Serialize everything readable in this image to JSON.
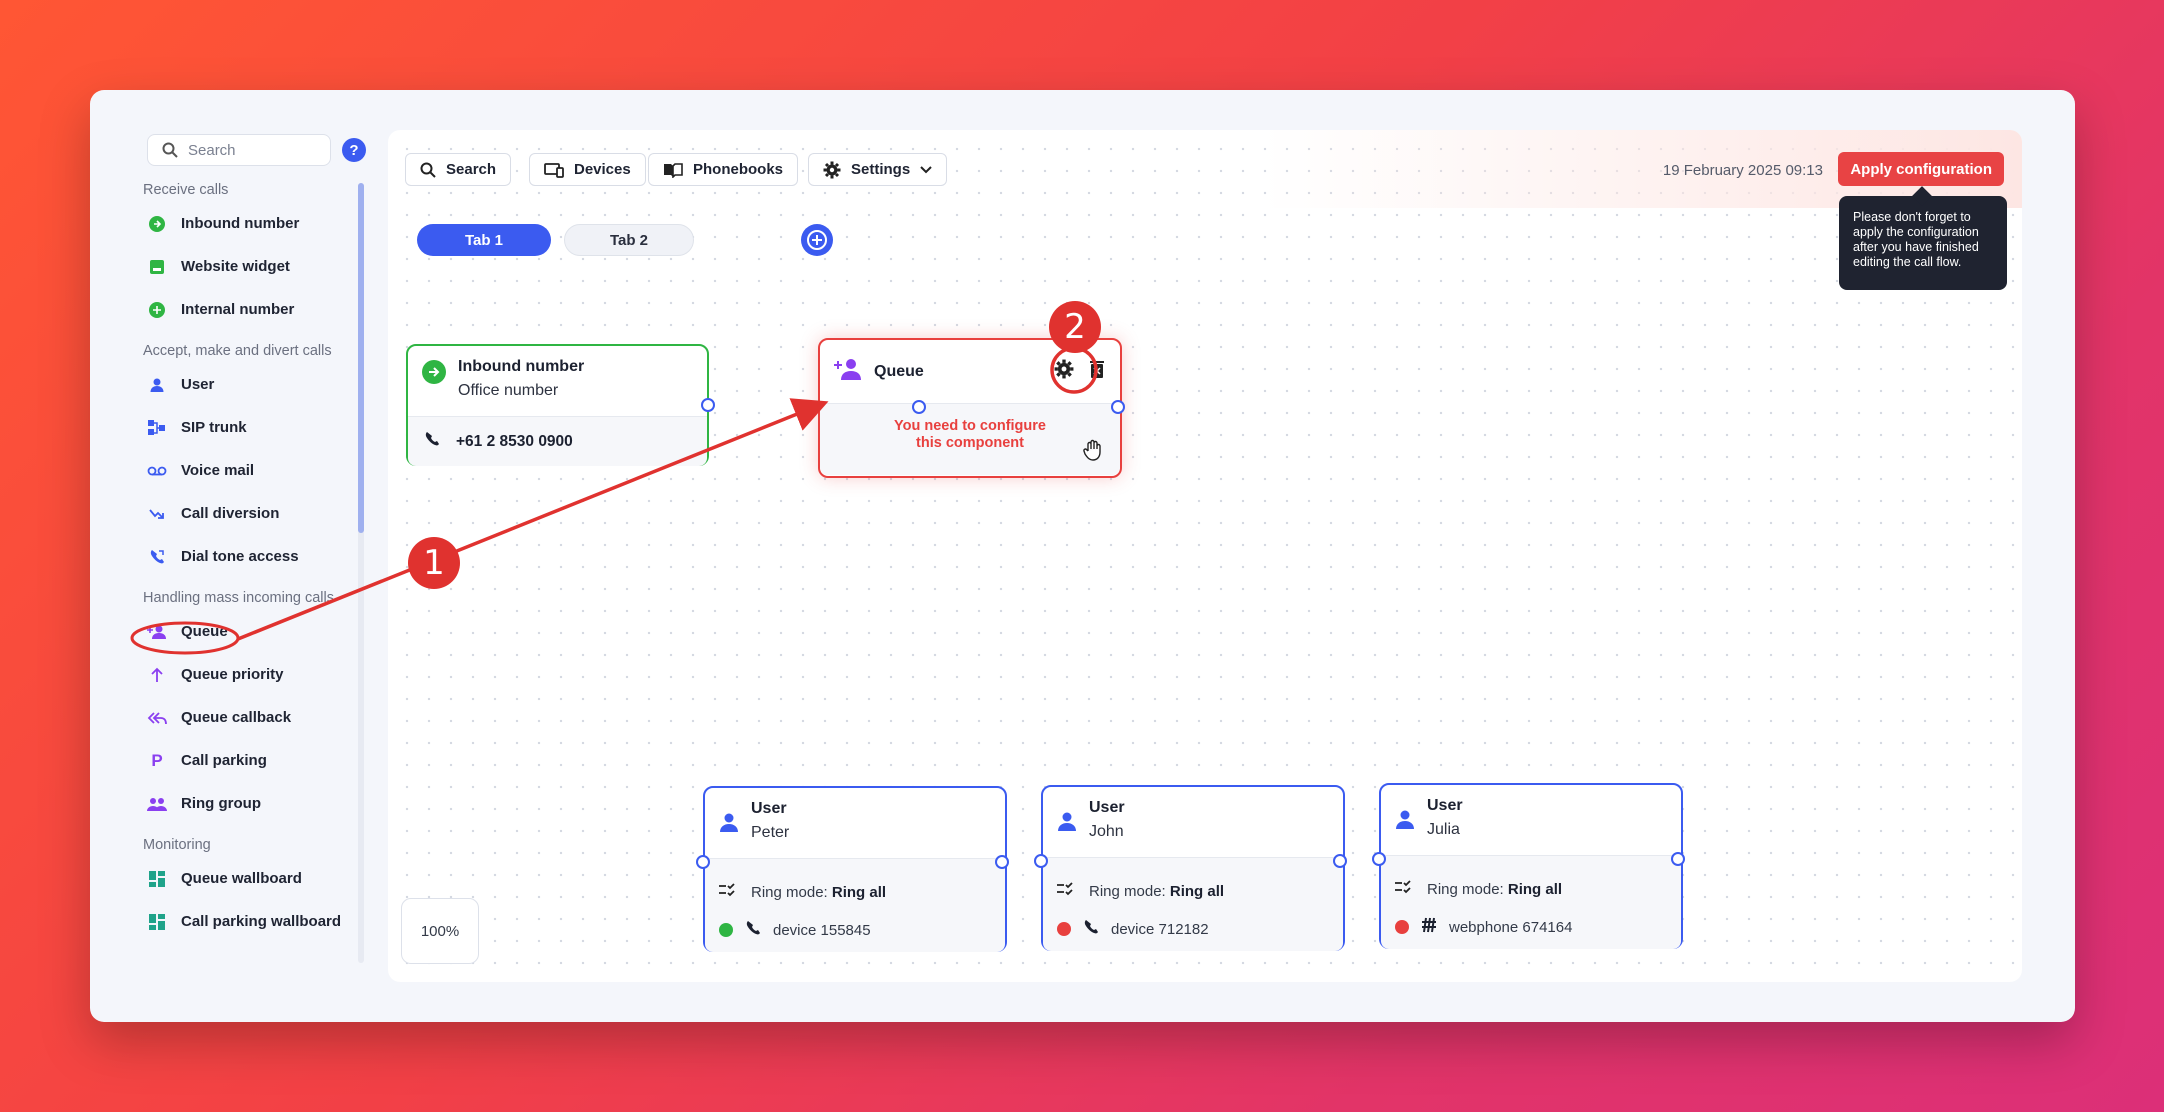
{
  "sidebar": {
    "search_placeholder": "Search",
    "help": "?",
    "sections": [
      {
        "heading": "Receive calls",
        "items": [
          "Inbound number",
          "Website widget",
          "Internal number"
        ]
      },
      {
        "heading": "Accept, make and divert calls",
        "items": [
          "User",
          "SIP trunk",
          "Voice mail",
          "Call diversion",
          "Dial tone access"
        ]
      },
      {
        "heading": "Handling mass incoming calls",
        "items": [
          "Queue",
          "Queue priority",
          "Queue callback",
          "Call parking",
          "Ring group"
        ]
      },
      {
        "heading": "Monitoring",
        "items": [
          "Queue wallboard",
          "Call parking wallboard"
        ]
      }
    ]
  },
  "toolbar": {
    "search": "Search",
    "devices": "Devices",
    "phonebooks": "Phonebooks",
    "settings": "Settings",
    "date": "19 February 2025 09:13",
    "apply": "Apply configuration",
    "tooltip": "Please don't forget to apply the configuration after you have finished editing the call flow."
  },
  "tabs": [
    "Tab 1",
    "Tab 2"
  ],
  "zoom": "100%",
  "nodes": {
    "inbound": {
      "title": "Inbound number",
      "sub": "Office number",
      "phone": "+61 2 8530 0900"
    },
    "queue": {
      "title": "Queue",
      "warning_line1": "You need to configure",
      "warning_line2": "this component"
    },
    "users": [
      {
        "title": "User",
        "name": "Peter",
        "ring_label": "Ring mode:",
        "ring_value": "Ring all",
        "device": "device 155845",
        "status_color": "#2fb543"
      },
      {
        "title": "User",
        "name": "John",
        "ring_label": "Ring mode:",
        "ring_value": "Ring all",
        "device": "device 712182",
        "status_color": "#e8403e"
      },
      {
        "title": "User",
        "name": "Julia",
        "ring_label": "Ring mode:",
        "ring_value": "Ring all",
        "device": "webphone 674164",
        "status_color": "#e8403e"
      }
    ]
  },
  "annotations": {
    "step1": "1",
    "step2": "2"
  },
  "colors": {
    "accent": "#3b5bf0",
    "danger": "#e8403e",
    "success": "#2fb543"
  }
}
